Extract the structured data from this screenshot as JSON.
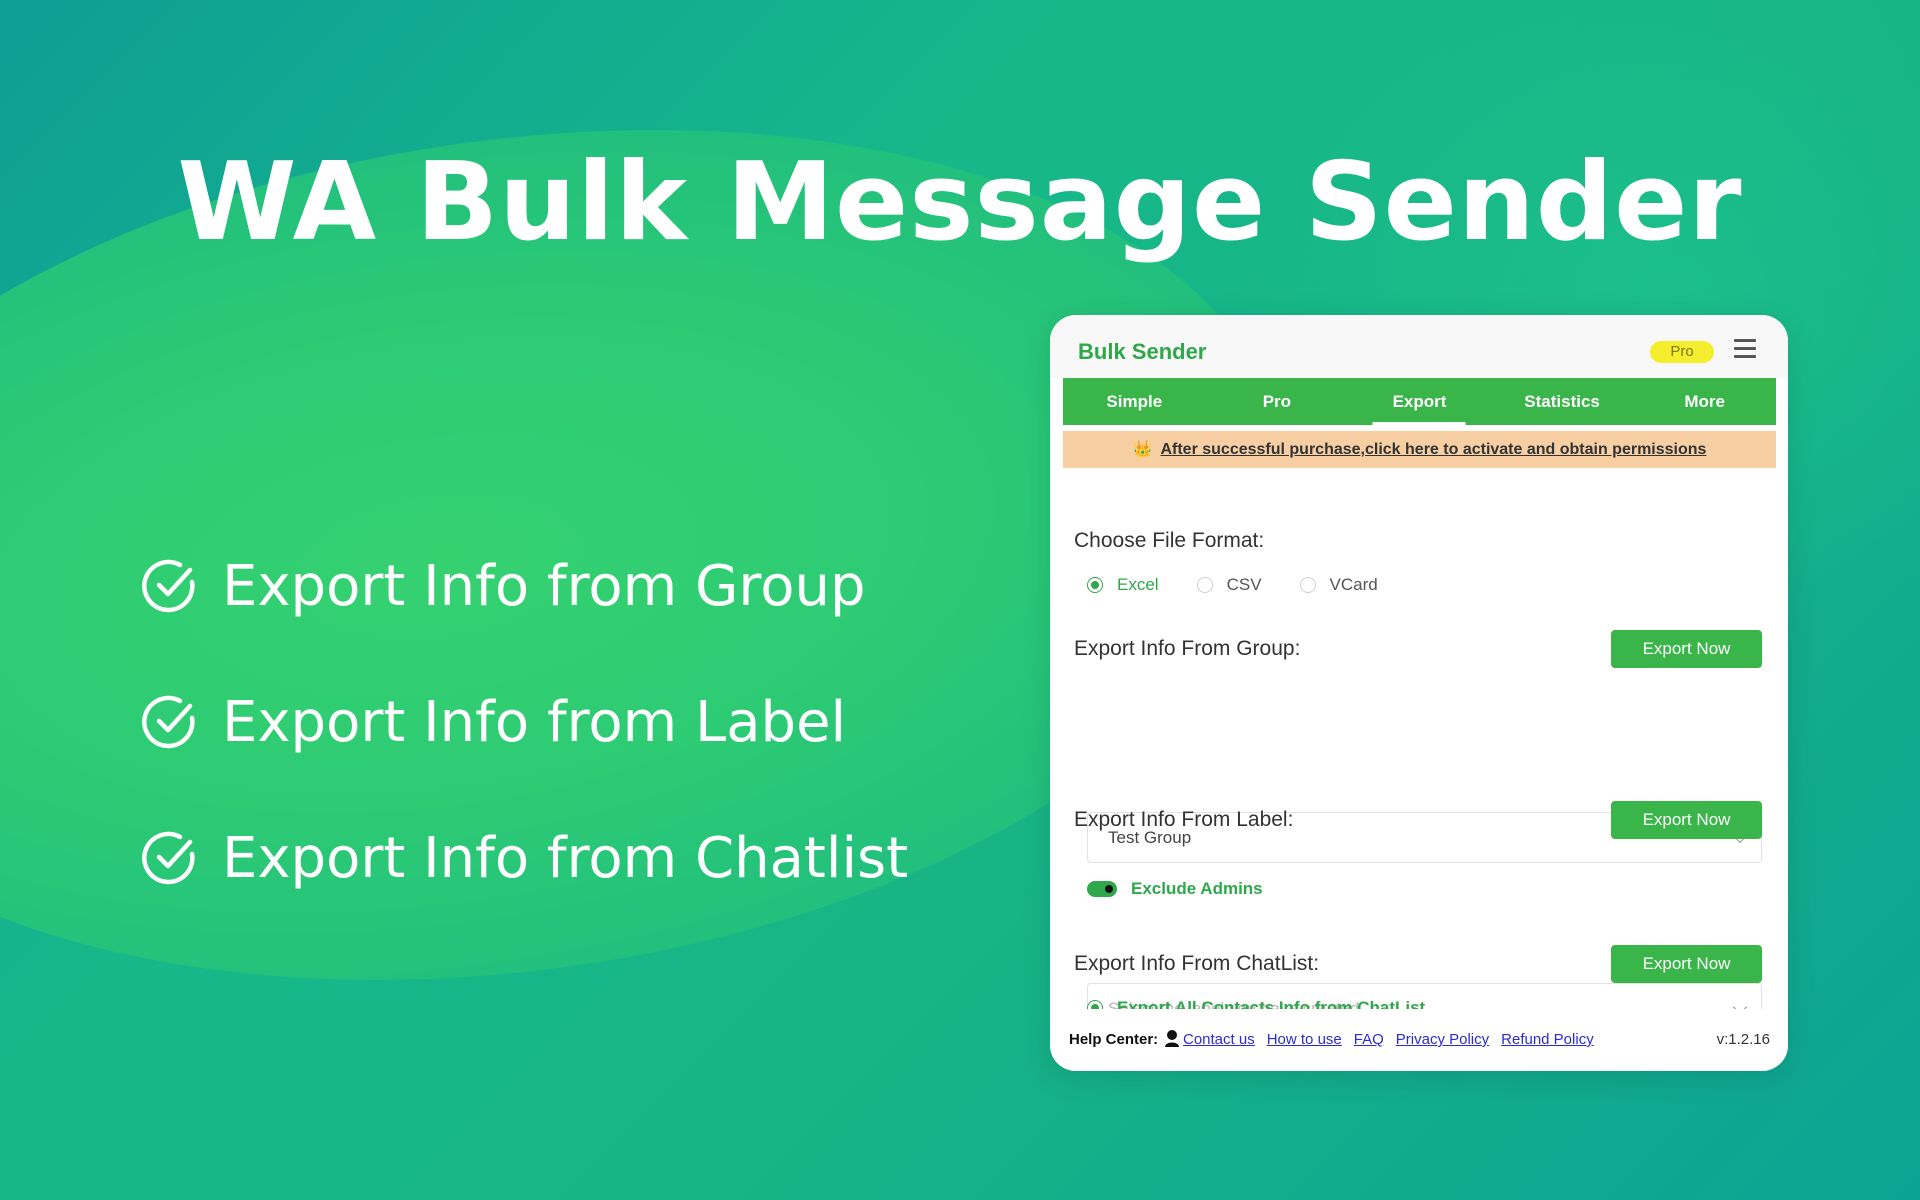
{
  "headline": "WA Bulk Message Sender",
  "features": [
    {
      "text": "Export Info from Group"
    },
    {
      "text": "Export Info from Label"
    },
    {
      "text": "Export Info from Chatlist"
    }
  ],
  "panel": {
    "brand": "Bulk Sender",
    "badge": "Pro",
    "tabs": [
      {
        "label": "Simple"
      },
      {
        "label": "Pro"
      },
      {
        "label": "Export"
      },
      {
        "label": "Statistics"
      },
      {
        "label": "More"
      }
    ],
    "active_tab": "Export",
    "notice": "After successful purchase,click here to activate and obtain permissions",
    "file_format": {
      "label": "Choose File Format:",
      "options": [
        "Excel",
        "CSV",
        "VCard"
      ],
      "selected": "Excel"
    },
    "group": {
      "label": "Export Info From Group:",
      "button": "Export Now",
      "select_value": "Test Group",
      "toggle_label": "Exclude Admins",
      "toggle_on": true
    },
    "label_section": {
      "label": "Export Info From Label:",
      "button": "Export Now",
      "placeholder": "Select the label you have created"
    },
    "chatlist": {
      "label": "Export Info From ChatList:",
      "button": "Export Now",
      "option": "Export All Contacts Info from ChatList"
    },
    "footer": {
      "help": "Help Center:",
      "links": [
        "Contact us",
        "How to use",
        "FAQ",
        "Privacy Policy",
        "Refund Policy"
      ],
      "version": "v:1.2.16"
    }
  },
  "colors": {
    "accent": "#39b54a",
    "notice_bg": "#f7cfa3",
    "badge_bg": "#f4ee2c"
  }
}
